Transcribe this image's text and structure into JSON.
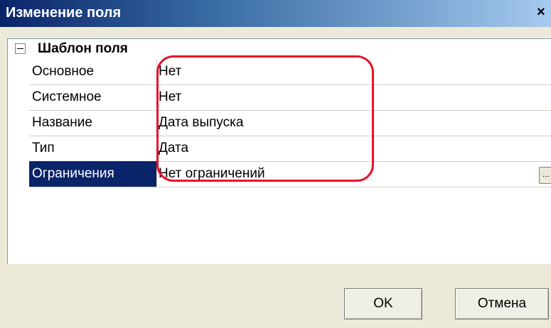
{
  "window": {
    "title": "Изменение поля",
    "close_glyph": "×"
  },
  "grid": {
    "category": "Шаблон поля",
    "rows": [
      {
        "name": "Основное",
        "value": "Нет"
      },
      {
        "name": "Системное",
        "value": "Нет"
      },
      {
        "name": "Название",
        "value": "Дата выпуска"
      },
      {
        "name": "Тип",
        "value": "Дата"
      },
      {
        "name": "Ограничения",
        "value": "Нет ограничений"
      }
    ],
    "selected_row": "Ограничения",
    "ellipsis_label": "..."
  },
  "buttons": {
    "ok": "OK",
    "cancel": "Отмена"
  },
  "colors": {
    "title_gradient_start": "#0a246a",
    "selection": "#0a246a",
    "highlight_annotation": "#e8112b"
  }
}
